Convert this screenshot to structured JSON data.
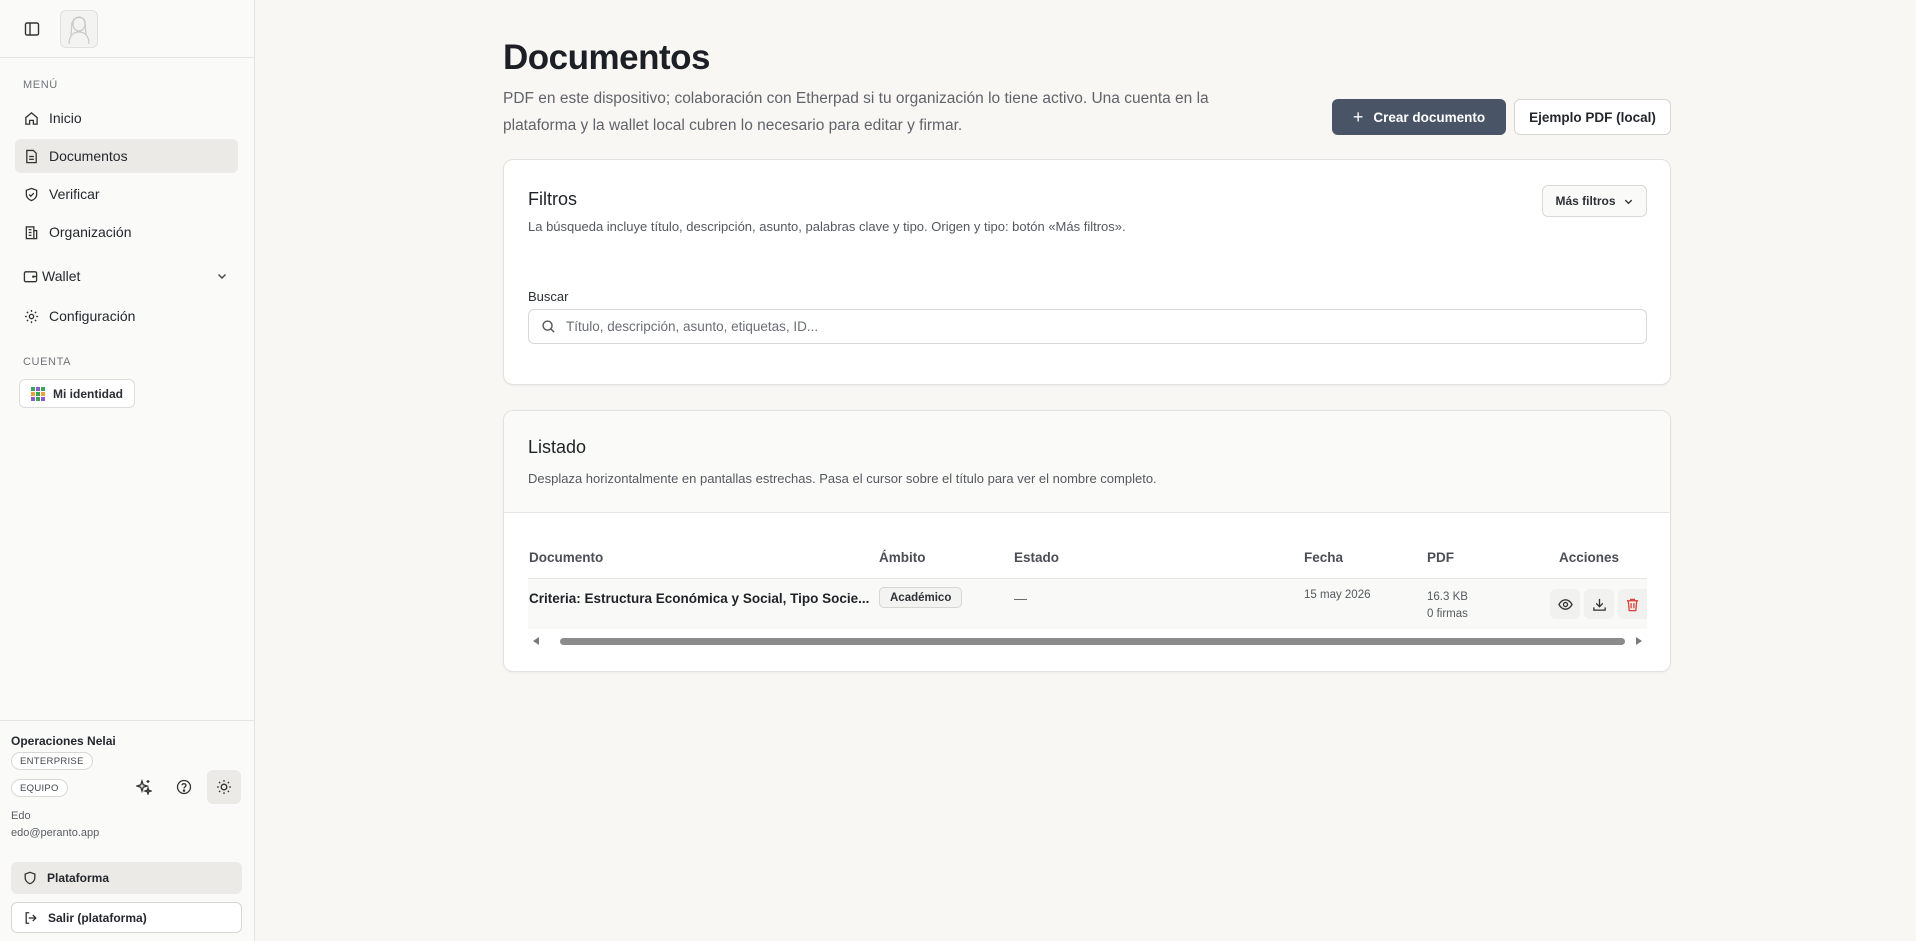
{
  "sidebar": {
    "menu_label": "MENÚ",
    "items": [
      {
        "label": "Inicio"
      },
      {
        "label": "Documentos"
      },
      {
        "label": "Verificar"
      },
      {
        "label": "Organización"
      },
      {
        "label": "Wallet"
      },
      {
        "label": "Configuración"
      }
    ],
    "account_label": "CUENTA",
    "identity_button": "Mi identidad",
    "org_name": "Operaciones Nelai",
    "badges": [
      "ENTERPRISE",
      "EQUIPO"
    ],
    "user_name": "Edo",
    "user_email": "edo@peranto.app",
    "platform_button": "Plataforma",
    "logout_button": "Salir (plataforma)"
  },
  "header": {
    "title": "Documentos",
    "description": "PDF en este dispositivo; colaboración con Etherpad si tu organización lo tiene activo. Una cuenta en la plataforma y la wallet local cubren lo necesario para editar y firmar.",
    "create_button": "Crear documento",
    "sample_button": "Ejemplo PDF (local)"
  },
  "filters": {
    "title": "Filtros",
    "description": "La búsqueda incluye título, descripción, asunto, palabras clave y tipo. Origen y tipo: botón «Más filtros».",
    "more_button": "Más filtros",
    "search_label": "Buscar",
    "search_value": "",
    "search_placeholder": "Título, descripción, asunto, etiquetas, ID..."
  },
  "listing": {
    "title": "Listado",
    "description": "Desplaza horizontalmente en pantallas estrechas. Pasa el cursor sobre el título para ver el nombre completo.",
    "columns": [
      "Documento",
      "Ámbito",
      "Estado",
      "Fecha",
      "PDF",
      "Acciones"
    ],
    "rows": [
      {
        "document": "Criteria: Estructura Económica y Social, Tipo Socie...",
        "scope": "Académico",
        "state": "—",
        "date": "15 may 2026",
        "size": "16.3 KB",
        "signatures": "0 firmas"
      }
    ]
  },
  "colors": {
    "primary_button": "#4a5467",
    "background": "#f8f7f4",
    "danger": "#d9413b"
  }
}
